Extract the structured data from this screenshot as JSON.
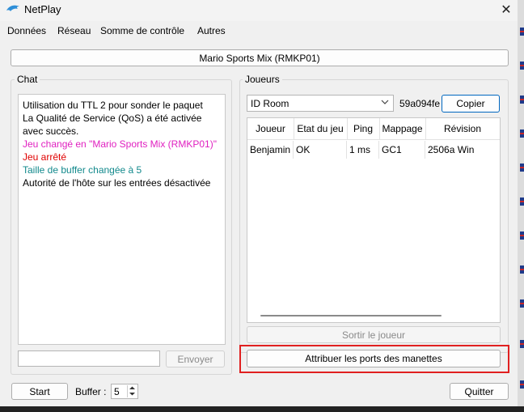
{
  "window": {
    "title": "NetPlay",
    "icon": "dolphin-icon",
    "close_glyph": "✕"
  },
  "menubar": {
    "items": [
      "Données",
      "Réseau",
      "Somme de contrôle",
      "Autres"
    ]
  },
  "game": {
    "label": "Mario Sports Mix (RMKP01)"
  },
  "chat": {
    "title": "Chat",
    "lines": [
      {
        "text": "Utilisation du TTL 2 pour sonder le paquet",
        "color": "#000000"
      },
      {
        "text": "La Qualité de Service (QoS) a été activée avec succès.",
        "color": "#000000"
      },
      {
        "text": "Jeu changé en \"Mario Sports Mix (RMKP01)\"",
        "color": "#e020c0"
      },
      {
        "text": "Jeu arrêté",
        "color": "#e00000"
      },
      {
        "text": "Taille de buffer changée à 5",
        "color": "#12898c"
      },
      {
        "text": "Autorité de l'hôte sur les entrées désactivée",
        "color": "#000000"
      }
    ],
    "input_value": "",
    "send_label": "Envoyer"
  },
  "players": {
    "title": "Joueurs",
    "room_select": "ID Room",
    "room_id": "59a094fe",
    "copy_label": "Copier",
    "columns": [
      "Joueur",
      "Etat du jeu",
      "Ping",
      "Mappage",
      "Révision"
    ],
    "rows": [
      [
        "Benjamin",
        "OK",
        "1 ms",
        "GC1",
        "2506a Win"
      ]
    ],
    "kick_label": "Sortir le joueur",
    "assign_label": "Attribuer les ports des manettes"
  },
  "bottom": {
    "start_label": "Start",
    "buffer_label": "Buffer :",
    "buffer_value": "5",
    "quit_label": "Quitter"
  },
  "colors": {
    "accent": "#0067c0",
    "highlight": "#e02020"
  }
}
